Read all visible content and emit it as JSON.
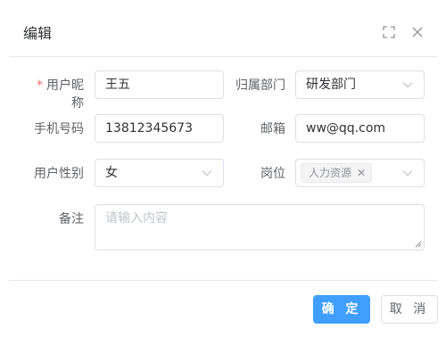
{
  "dialog": {
    "title": "编辑"
  },
  "form": {
    "nickname": {
      "label": "用户昵称",
      "required_mark": "*",
      "value": "王五"
    },
    "department": {
      "label": "归属部门",
      "value": "研发部门"
    },
    "phone": {
      "label": "手机号码",
      "value": "13812345673"
    },
    "email": {
      "label": "邮箱",
      "value": "ww@qq.com"
    },
    "gender": {
      "label": "用户性别",
      "value": "女"
    },
    "position": {
      "label": "岗位",
      "tags": [
        "人力资源"
      ]
    },
    "remark": {
      "label": "备注",
      "placeholder": "请输入内容",
      "value": ""
    }
  },
  "footer": {
    "confirm_label": "确 定",
    "cancel_label": "取 消"
  },
  "icons": {
    "fullscreen": "fullscreen-icon",
    "close": "close-icon",
    "dropdown": "chevron-down-icon",
    "tag_close": "close-icon",
    "resize": "resize-handle-icon"
  },
  "colors": {
    "primary": "#409eff",
    "required": "#f56c6c",
    "border": "#dcdfe6",
    "placeholder": "#c0c4cc"
  }
}
